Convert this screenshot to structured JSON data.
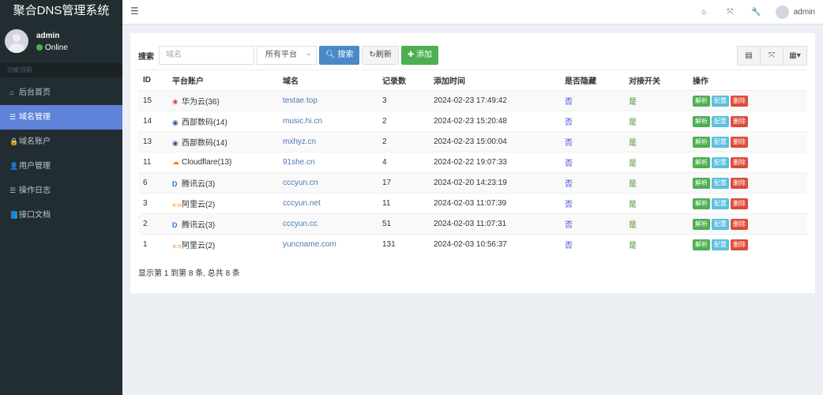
{
  "app": {
    "title": "聚合DNS管理系统"
  },
  "user": {
    "name": "admin",
    "status": "Online"
  },
  "sidebar": {
    "header": "功能导航",
    "items": [
      {
        "label": "后台首页",
        "icon": "home-icon",
        "glyph": "⌂"
      },
      {
        "label": "域名管理",
        "icon": "list-icon",
        "glyph": "☰",
        "active": true
      },
      {
        "label": "域名账户",
        "icon": "lock-icon",
        "glyph": "🔒"
      },
      {
        "label": "用户管理",
        "icon": "user-icon",
        "glyph": "👤"
      },
      {
        "label": "操作日志",
        "icon": "list-icon",
        "glyph": "☰"
      },
      {
        "label": "接口文档",
        "icon": "book-icon",
        "glyph": "📘"
      }
    ]
  },
  "header": {
    "user": "admin"
  },
  "toolbar": {
    "search_label": "搜索",
    "search_placeholder": "域名",
    "platform": "所有平台",
    "search_btn": "搜索",
    "refresh_btn": "刷新",
    "add_btn": "添加"
  },
  "table": {
    "columns": [
      "ID",
      "平台账户",
      "域名",
      "记录数",
      "添加时间",
      "是否隐藏",
      "对接开关",
      "操作"
    ],
    "actions": [
      "解析",
      "配置",
      "删除"
    ],
    "rows": [
      {
        "id": "15",
        "platform": "华为云(36)",
        "picon": "huawei",
        "domain": "testae.top",
        "records": "3",
        "time": "2024-02-23 17:49:42",
        "hidden": "否",
        "sync": "是"
      },
      {
        "id": "14",
        "platform": "西部数码(14)",
        "picon": "west",
        "domain": "music.hi.cn",
        "records": "2",
        "time": "2024-02-23 15:20:48",
        "hidden": "否",
        "sync": "是"
      },
      {
        "id": "13",
        "platform": "西部数码(14)",
        "picon": "west",
        "domain": "mxhyz.cn",
        "records": "2",
        "time": "2024-02-23 15:00:04",
        "hidden": "否",
        "sync": "是"
      },
      {
        "id": "11",
        "platform": "Cloudflare(13)",
        "picon": "cloudflare",
        "domain": "91she.cn",
        "records": "4",
        "time": "2024-02-22 19:07:33",
        "hidden": "否",
        "sync": "是"
      },
      {
        "id": "6",
        "platform": "腾讯云(3)",
        "picon": "dnspod",
        "domain": "cccyun.cn",
        "records": "17",
        "time": "2024-02-20 14:23:19",
        "hidden": "否",
        "sync": "是"
      },
      {
        "id": "3",
        "platform": "阿里云(2)",
        "picon": "aliyun",
        "domain": "cccyun.net",
        "records": "11",
        "time": "2024-02-03 11:07:39",
        "hidden": "否",
        "sync": "是"
      },
      {
        "id": "2",
        "platform": "腾讯云(3)",
        "picon": "dnspod",
        "domain": "cccyun.cc",
        "records": "51",
        "time": "2024-02-03 11:07:31",
        "hidden": "否",
        "sync": "是"
      },
      {
        "id": "1",
        "platform": "阿里云(2)",
        "picon": "aliyun",
        "domain": "yuncname.com",
        "records": "131",
        "time": "2024-02-03 10:56:37",
        "hidden": "否",
        "sync": "是"
      }
    ]
  },
  "footer": {
    "text": "显示第 1 到第 8 条, 总共 8 条"
  }
}
